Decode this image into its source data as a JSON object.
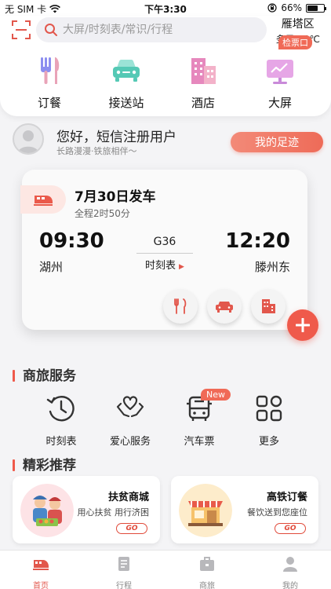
{
  "status_bar": {
    "carrier": "无 SIM 卡",
    "time": "下午3:30",
    "battery": "66%",
    "battery_level": 0.66
  },
  "header": {
    "search_placeholder": "大屏/时刻表/常识/行程",
    "weather_city": "雁塔区",
    "weather_condition": "多云 28℃",
    "quick_links": [
      {
        "label": "订餐",
        "icon": "fork-knife-icon"
      },
      {
        "label": "接送站",
        "icon": "car-icon"
      },
      {
        "label": "酒店",
        "icon": "hotel-icon"
      },
      {
        "label": "大屏",
        "icon": "screen-icon"
      }
    ],
    "ticket_badge": "检票口"
  },
  "user": {
    "greeting": "您好，短信注册用户",
    "slogan": "长路漫漫·铁旅相伴～",
    "footprint_label": "我的足迹"
  },
  "trip": {
    "date": "7月30日发车",
    "duration": "全程2时50分",
    "depart_time": "09:30",
    "arrive_time": "12:20",
    "train_no": "G36",
    "schedule_label": "时刻表",
    "from_station": "湖州",
    "to_station": "滕州东"
  },
  "business": {
    "title": "商旅服务",
    "items": [
      {
        "label": "时刻表",
        "icon": "clock-icon"
      },
      {
        "label": "爱心服务",
        "icon": "heart-hands-icon"
      },
      {
        "label": "汽车票",
        "icon": "bus-icon"
      },
      {
        "label": "更多",
        "icon": "more-grid-icon"
      }
    ],
    "new_badge": "New"
  },
  "recommend": {
    "title": "精彩推荐",
    "cards": [
      {
        "title": "扶贫商城",
        "subtitle": "用心扶贫 用行济困",
        "go": "GO"
      },
      {
        "title": "高铁订餐",
        "subtitle": "餐饮送到您座位",
        "go": "GO"
      }
    ]
  },
  "tabbar": {
    "tabs": [
      {
        "label": "首页",
        "active": true
      },
      {
        "label": "行程",
        "active": false
      },
      {
        "label": "商旅",
        "active": false
      },
      {
        "label": "我的",
        "active": false
      }
    ]
  },
  "colors": {
    "accent": "#ef5a4b",
    "background": "#f4f4f6"
  }
}
